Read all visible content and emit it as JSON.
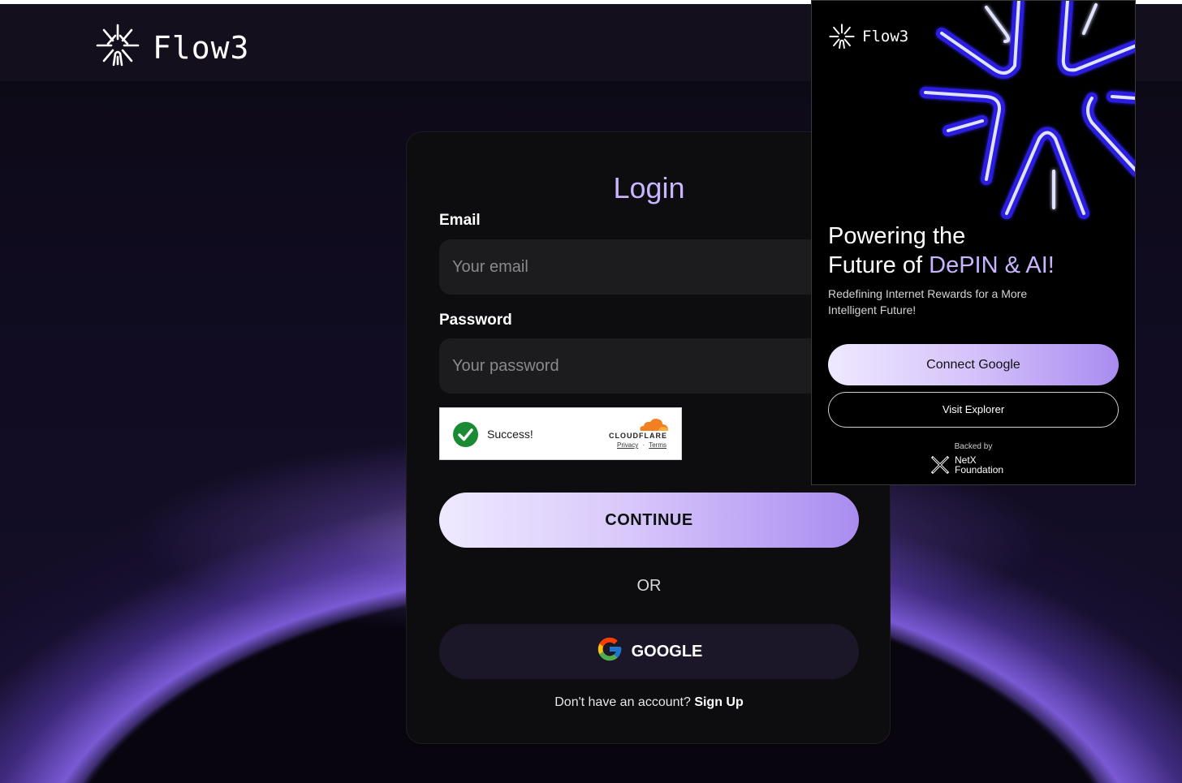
{
  "app": {
    "brand": "Flow3"
  },
  "login": {
    "title": "Login",
    "email_label": "Email",
    "email_placeholder": "Your email",
    "email_value": "",
    "password_label": "Password",
    "password_placeholder": "Your password",
    "password_value": "",
    "captcha": {
      "status": "Success!",
      "brand": "CLOUDFLARE",
      "privacy": "Privacy",
      "separator": "·",
      "terms": "Terms"
    },
    "continue_label": "CONTINUE",
    "or_text": "OR",
    "google_label": "GOOGLE",
    "signup_prompt": "Don't have an account?",
    "signup_link": "Sign Up"
  },
  "extension_popup": {
    "brand": "Flow3",
    "headline_line1": "Powering the",
    "headline_line2_prefix": "Future of ",
    "headline_accent": "DePIN & AI!",
    "subtitle": "Redefining Internet Rewards for a More Intelligent Future!",
    "connect_label": "Connect Google",
    "explorer_label": "Visit Explorer",
    "backed_by": "Backed by",
    "backer_line1": "NetX",
    "backer_line2": "Foundation"
  },
  "colors": {
    "accent": "#c9b4ff",
    "button_gradient_end": "#a98cf0",
    "captcha_success": "#1a8a34",
    "cloudflare_orange": "#f38020"
  },
  "icons": [
    "flow3-logo-icon",
    "check-icon",
    "cloudflare-cloud-icon",
    "google-g-icon",
    "netx-logo-icon"
  ]
}
